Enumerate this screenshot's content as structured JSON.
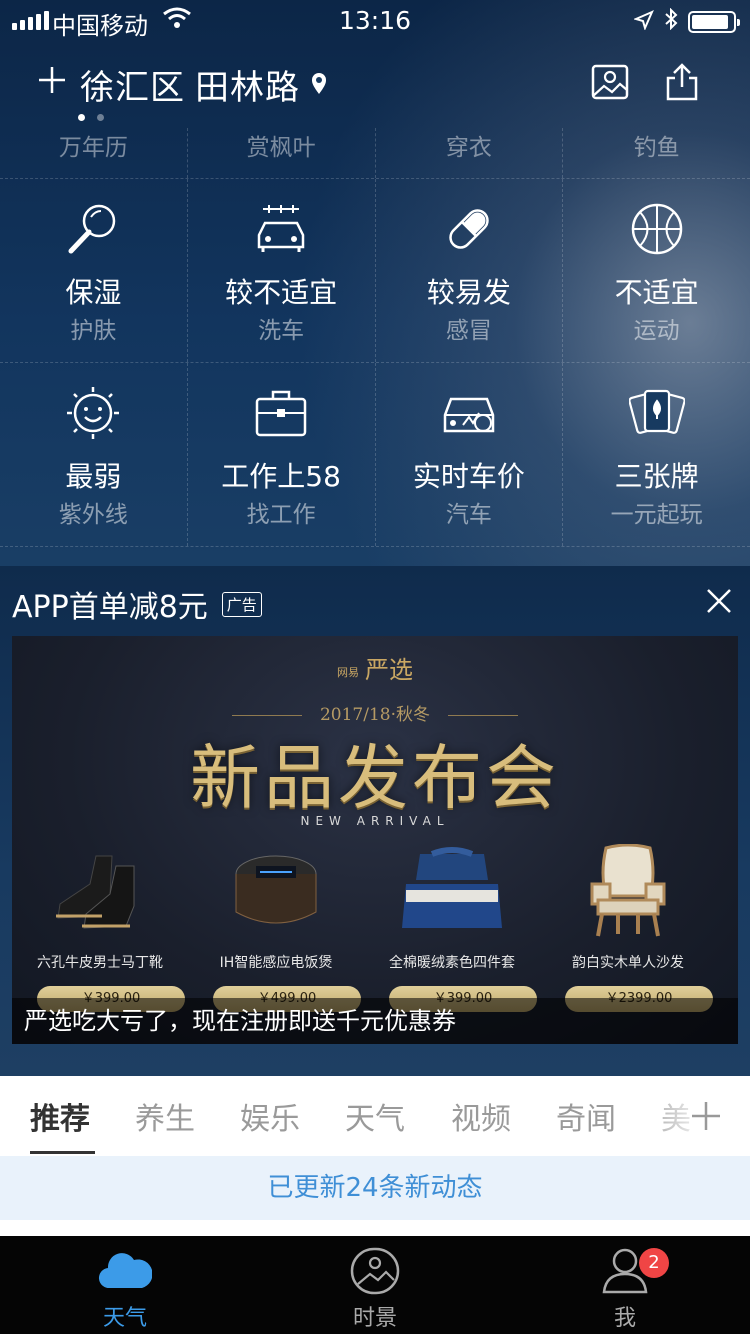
{
  "status_bar": {
    "carrier": "中国移动",
    "time": "13:16"
  },
  "header": {
    "district": "徐汇区",
    "road": "田林路"
  },
  "index_top_row": [
    "万年历",
    "赏枫叶",
    "穿衣",
    "钓鱼"
  ],
  "index_rows": [
    [
      {
        "icon": "magnifier-icon",
        "value": "保湿",
        "label": "护肤"
      },
      {
        "icon": "car-wash-icon",
        "value": "较不适宜",
        "label": "洗车"
      },
      {
        "icon": "pill-icon",
        "value": "较易发",
        "label": "感冒"
      },
      {
        "icon": "basketball-icon",
        "value": "不适宜",
        "label": "运动"
      }
    ],
    [
      {
        "icon": "sun-face-icon",
        "value": "最弱",
        "label": "紫外线"
      },
      {
        "icon": "briefcase-icon",
        "value": "工作上58",
        "label": "找工作"
      },
      {
        "icon": "car-price-icon",
        "value": "实时车价",
        "label": "汽车"
      },
      {
        "icon": "playing-cards-icon",
        "value": "三张牌",
        "label": "一元起玩"
      }
    ]
  ],
  "ad": {
    "title": "APP首单减8元",
    "tag": "广告",
    "banner": {
      "brand_small": "网易",
      "brand": "严选",
      "season": "2017/18·秋冬",
      "headline": "新品发布会",
      "subheadline": "NEW ARRIVAL",
      "products": [
        {
          "name": "六孔牛皮男士马丁靴",
          "price": "￥399.00"
        },
        {
          "name": "IH智能感应电饭煲",
          "price": "￥499.00"
        },
        {
          "name": "全棉暖绒素色四件套",
          "price": "￥399.00"
        },
        {
          "name": "韵白实木单人沙发",
          "price": "￥2399.00"
        }
      ],
      "caption": "严选吃大亏了，现在注册即送千元优惠券"
    }
  },
  "news_tabs": [
    "推荐",
    "养生",
    "娱乐",
    "天气",
    "视频",
    "奇闻",
    "美"
  ],
  "update_notice": "已更新24条新动态",
  "bottom_nav": [
    {
      "label": "天气",
      "icon": "cloud-icon"
    },
    {
      "label": "时景",
      "icon": "photo-icon"
    },
    {
      "label": "我",
      "icon": "person-icon",
      "badge": "2"
    }
  ],
  "colors": {
    "active_blue": "#3c9be8",
    "badge_red": "#f04545",
    "gold": "#d8bd7c"
  }
}
